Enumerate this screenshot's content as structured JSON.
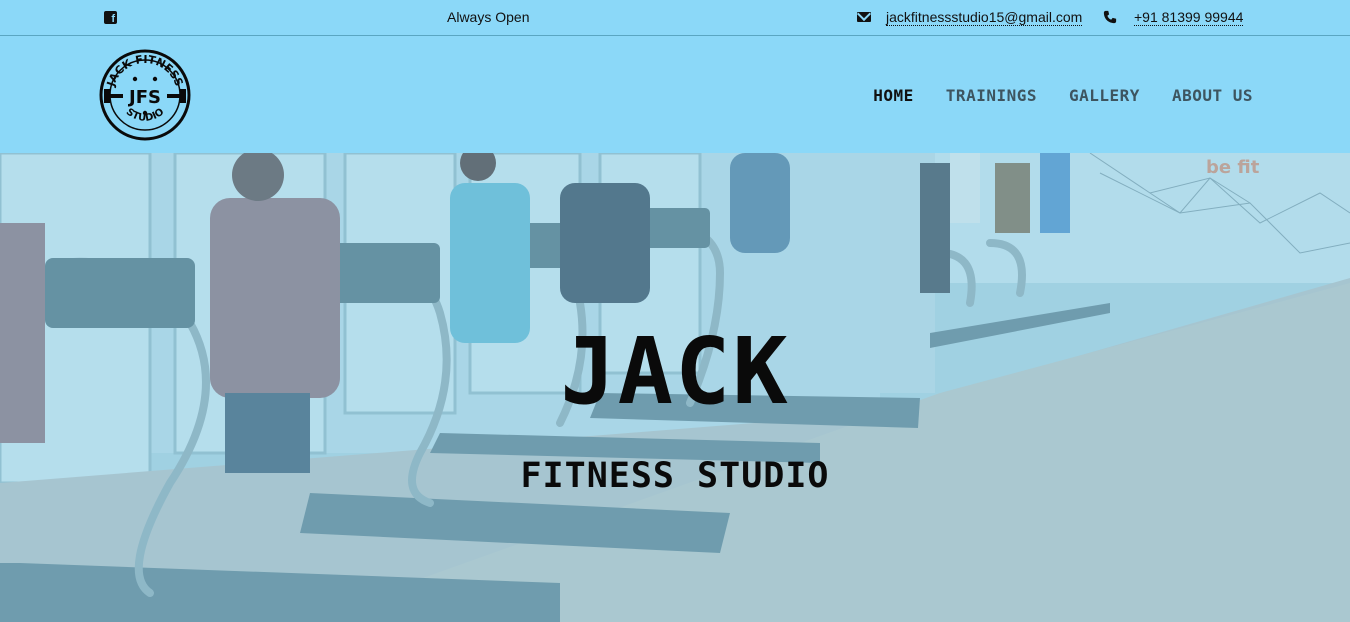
{
  "topbar": {
    "social_icon": "facebook-icon",
    "hours": "Always Open",
    "email_icon": "envelope-icon",
    "email": "jackfitnessstudio15@gmail.com",
    "phone_icon": "phone-icon",
    "phone": "+91 81399 99944"
  },
  "brand": {
    "logo_top_text": "JACK FITNESS",
    "logo_mono": "JFS",
    "logo_bottom_text": "STUDIO"
  },
  "nav": {
    "items": [
      {
        "label": "HOME",
        "active": true
      },
      {
        "label": "TRAININGS",
        "active": false
      },
      {
        "label": "GALLERY",
        "active": false
      },
      {
        "label": "ABOUT US",
        "active": false
      }
    ]
  },
  "hero": {
    "title": "JACK",
    "subtitle": "FITNESS STUDIO",
    "wall_text": "be fit"
  },
  "colors": {
    "header_bg": "#8bd8f8",
    "hero_overlay": "#8fd3ef",
    "text": "#111111"
  }
}
